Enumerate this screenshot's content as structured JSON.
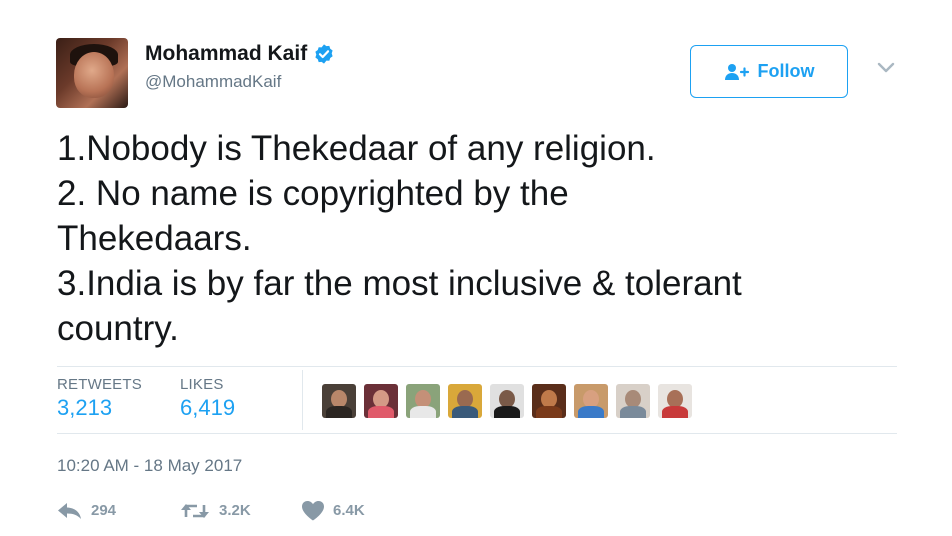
{
  "tweet": {
    "author": {
      "name": "Mohammad Kaif",
      "handle": "@MohammadKaif",
      "verified": true
    },
    "follow_label": "Follow",
    "text_lines": [
      "1.Nobody is Thekedaar of any religion.",
      "2. No name is copyrighted by the",
      "Thekedaars.",
      "3.India is by far the most inclusive & tolerant",
      "country."
    ],
    "stats": {
      "retweets_label": "RETWEETS",
      "retweets_value": "3,213",
      "likes_label": "LIKES",
      "likes_value": "6,419"
    },
    "timestamp": "10:20 AM - 18 May 2017",
    "actions": {
      "reply_count": "294",
      "retweet_count": "3.2K",
      "like_count": "6.4K"
    }
  },
  "colors": {
    "accent": "#1da1f2",
    "text": "#14171a",
    "muted": "#657786",
    "action_gray": "#8899a6"
  },
  "icons": [
    "verified-badge-icon",
    "follow-person-icon",
    "chevron-down-icon",
    "reply-icon",
    "retweet-icon",
    "heart-icon"
  ]
}
